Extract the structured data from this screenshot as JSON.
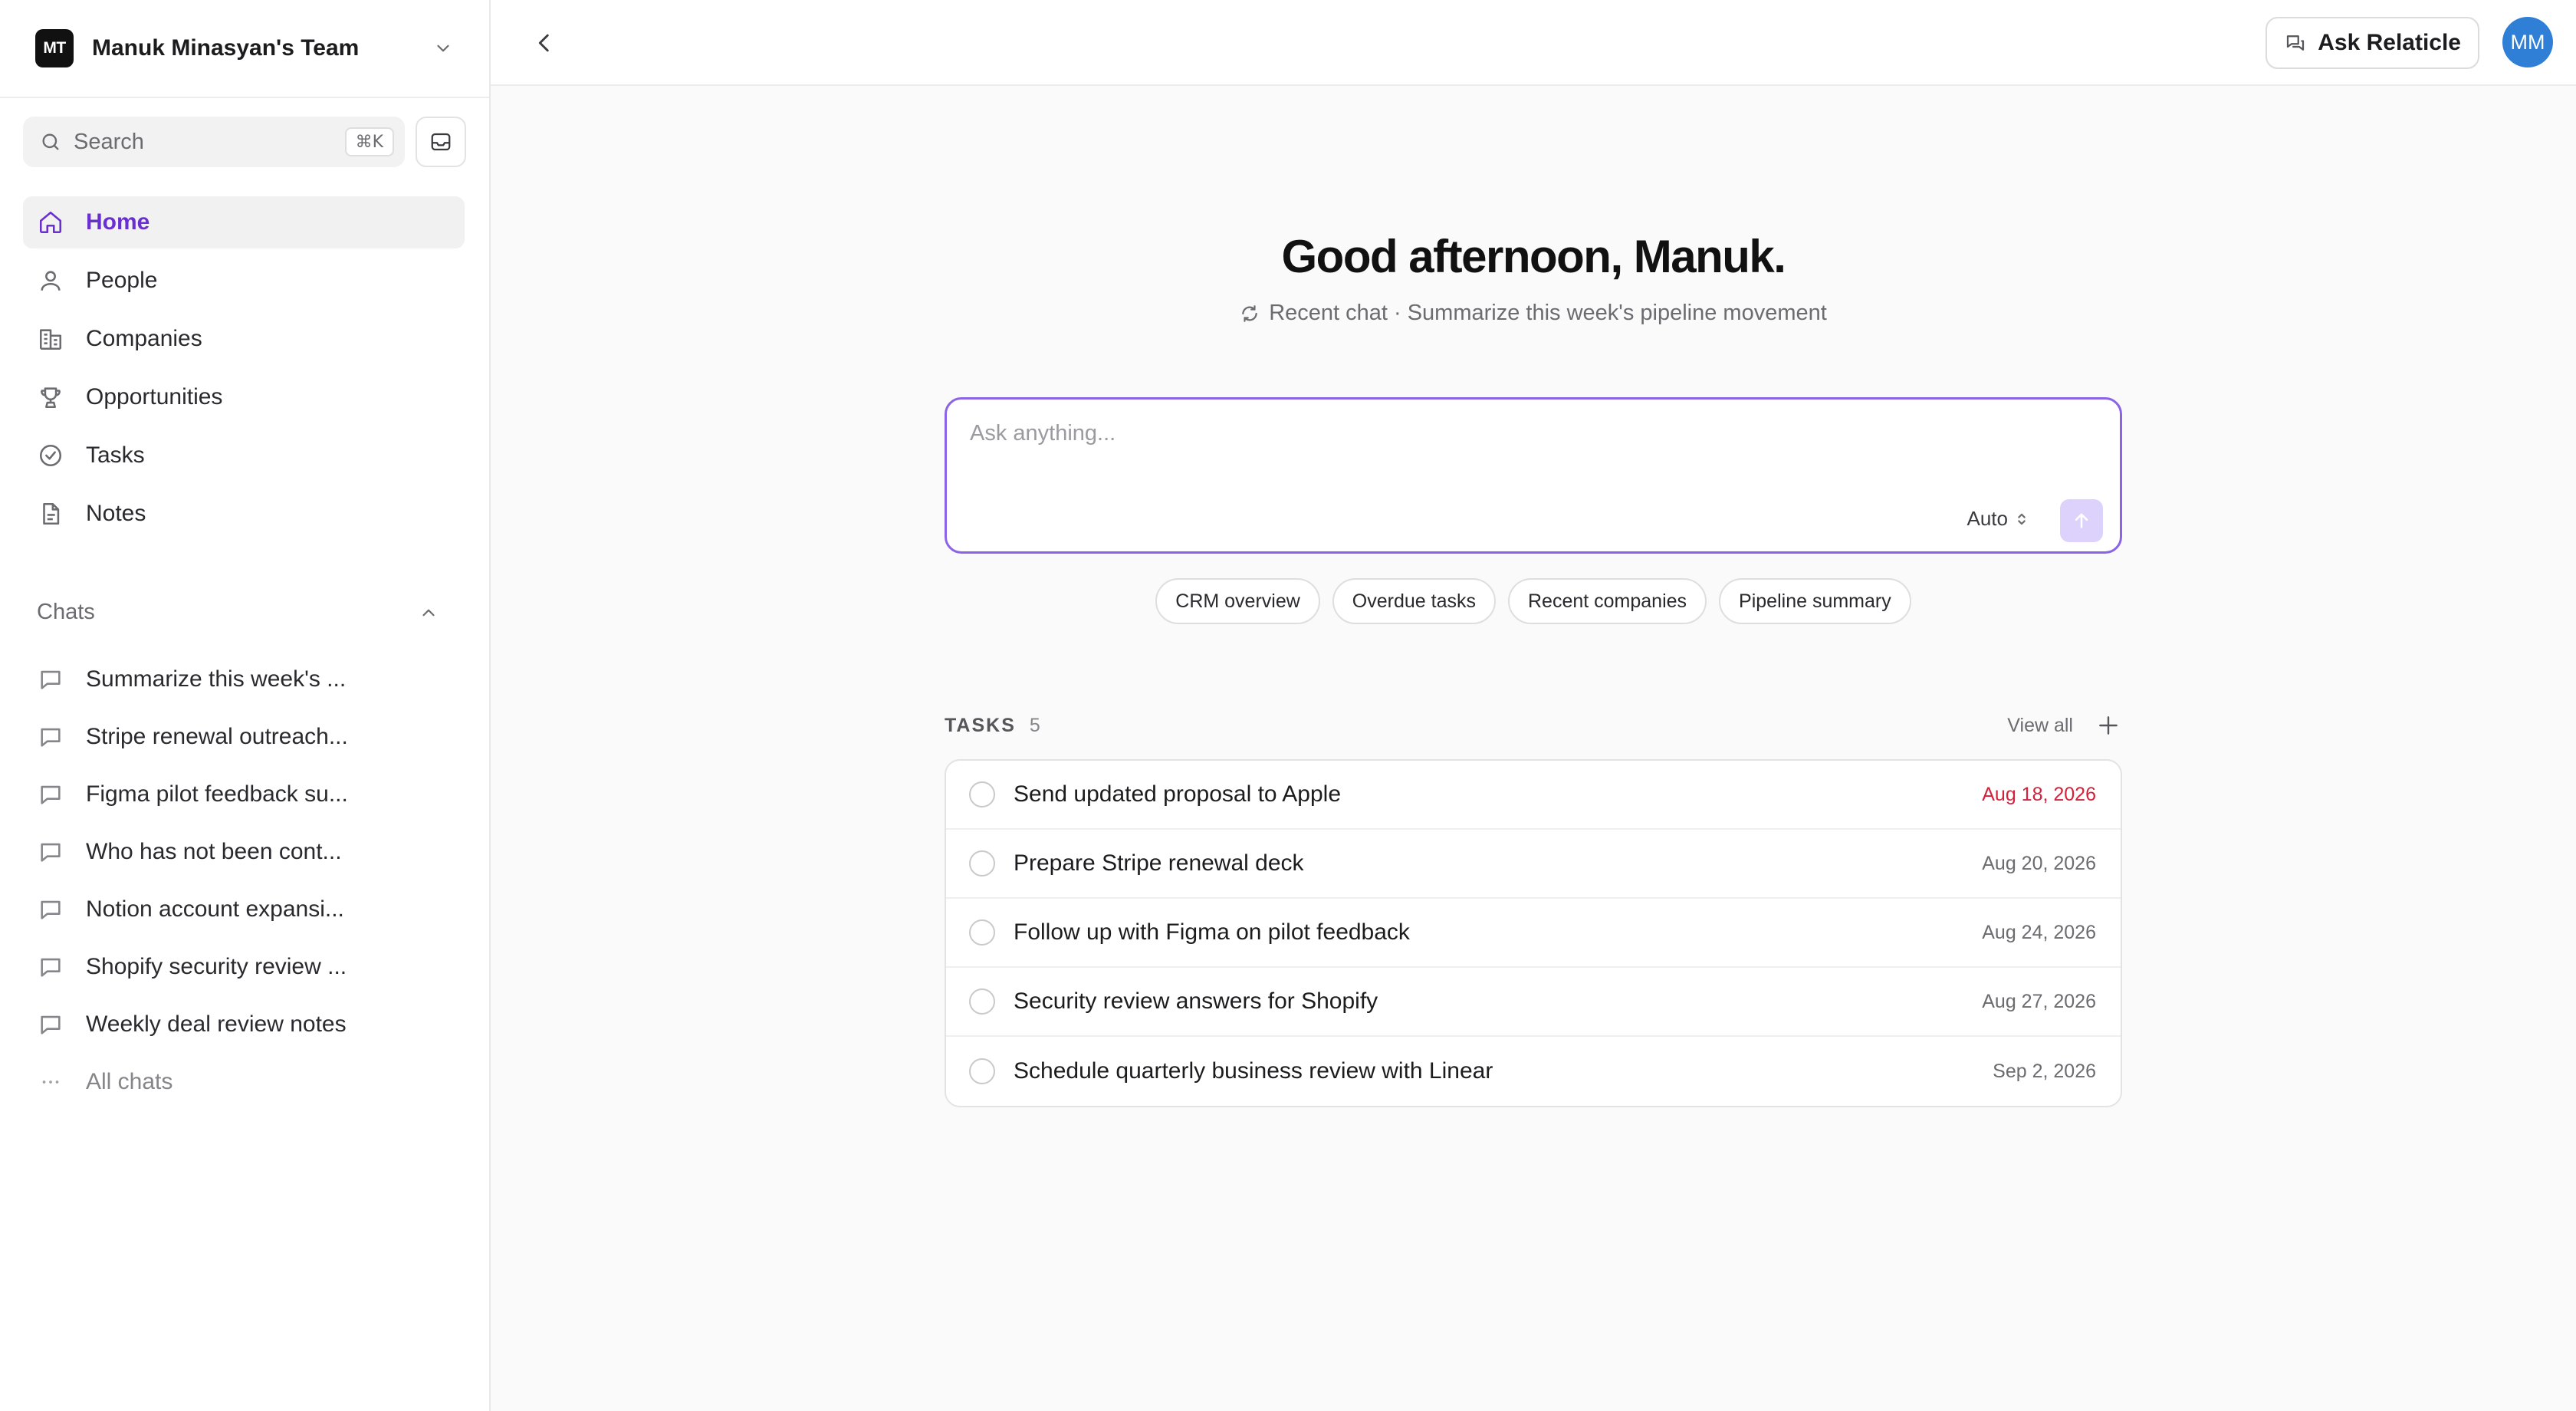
{
  "team": {
    "initials": "MT",
    "name": "Manuk Minasyan's Team"
  },
  "search": {
    "label": "Search",
    "shortcut": "⌘K"
  },
  "nav": [
    {
      "label": "Home",
      "icon": "home-icon",
      "active": true
    },
    {
      "label": "People",
      "icon": "person-icon"
    },
    {
      "label": "Companies",
      "icon": "building-icon"
    },
    {
      "label": "Opportunities",
      "icon": "trophy-icon"
    },
    {
      "label": "Tasks",
      "icon": "check-circle-icon"
    },
    {
      "label": "Notes",
      "icon": "document-icon"
    }
  ],
  "chats": {
    "title": "Chats",
    "items": [
      "Summarize this week's ...",
      "Stripe renewal outreach...",
      "Figma pilot feedback su...",
      "Who has not been cont...",
      "Notion account expansi...",
      "Shopify security review ...",
      "Weekly deal review notes"
    ],
    "all_label": "All chats"
  },
  "topbar": {
    "ask_label": "Ask Relaticle",
    "avatar_initials": "MM"
  },
  "main": {
    "greeting": "Good afternoon, Manuk.",
    "recent_chat": "Recent chat · Summarize this week's pipeline movement",
    "composer": {
      "placeholder": "Ask anything...",
      "value": "",
      "mode": "Auto"
    },
    "chips": [
      "CRM overview",
      "Overdue tasks",
      "Recent companies",
      "Pipeline summary"
    ],
    "tasks": {
      "title": "TASKS",
      "count": "5",
      "view_all": "View all",
      "items": [
        {
          "title": "Send updated proposal to Apple",
          "date": "Aug 18, 2026",
          "overdue": true
        },
        {
          "title": "Prepare Stripe renewal deck",
          "date": "Aug 20, 2026"
        },
        {
          "title": "Follow up with Figma on pilot feedback",
          "date": "Aug 24, 2026"
        },
        {
          "title": "Security review answers for Shopify",
          "date": "Aug 27, 2026"
        },
        {
          "title": "Schedule quarterly business review with Linear",
          "date": "Sep 2, 2026"
        }
      ]
    }
  },
  "colors": {
    "accent": "#6a2fd0",
    "composer_border": "#8b63e6",
    "overdue": "#d4213b",
    "avatar": "#2f7fd6"
  }
}
